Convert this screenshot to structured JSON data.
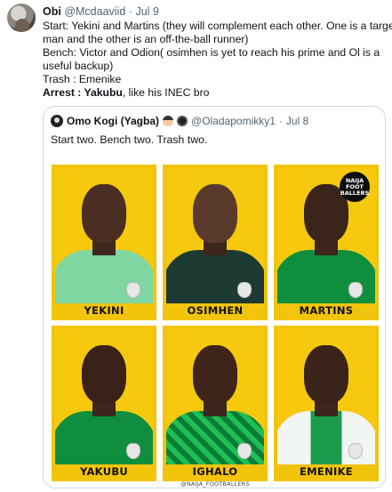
{
  "tweet": {
    "author_name": "Obi",
    "author_handle": "@Mcdaaviid",
    "separator": "·",
    "date": "Jul 9",
    "lines": [
      "Start: Yekini and Martins (they will complement each other. One is a target",
      "man and the other is an off-the-ball runner)",
      "Bench: Victor  and Odion( osimhen is yet to reach his prime and Ol is a",
      "useful backup)",
      "Trash : Emenike"
    ],
    "arrest_label": "Arrest",
    "arrest_sep": " : ",
    "arrest_name": "Yakubu",
    "arrest_rest": ", like his INEC bro"
  },
  "quote": {
    "author_name": "Omo Kogi (Yagba)",
    "author_handle": "@Oladapomikky1",
    "separator": "·",
    "date": "Jul 8",
    "text": "Start two. Bench two. Trash two.",
    "badge": [
      "NAIJA",
      "FOOT",
      "BALLERS"
    ],
    "watermark": "@NAIJA_FOOTBALLERS",
    "players": [
      "YEKINI",
      "OSIMHEN",
      "MARTINS",
      "YAKUBU",
      "IGHALO",
      "EMENIKE"
    ]
  },
  "colors": {
    "card_yellow": "#f2c40c",
    "nigeria_green": "#0f8f3e",
    "secondary_text": "#536471",
    "border": "#cfd9de"
  }
}
